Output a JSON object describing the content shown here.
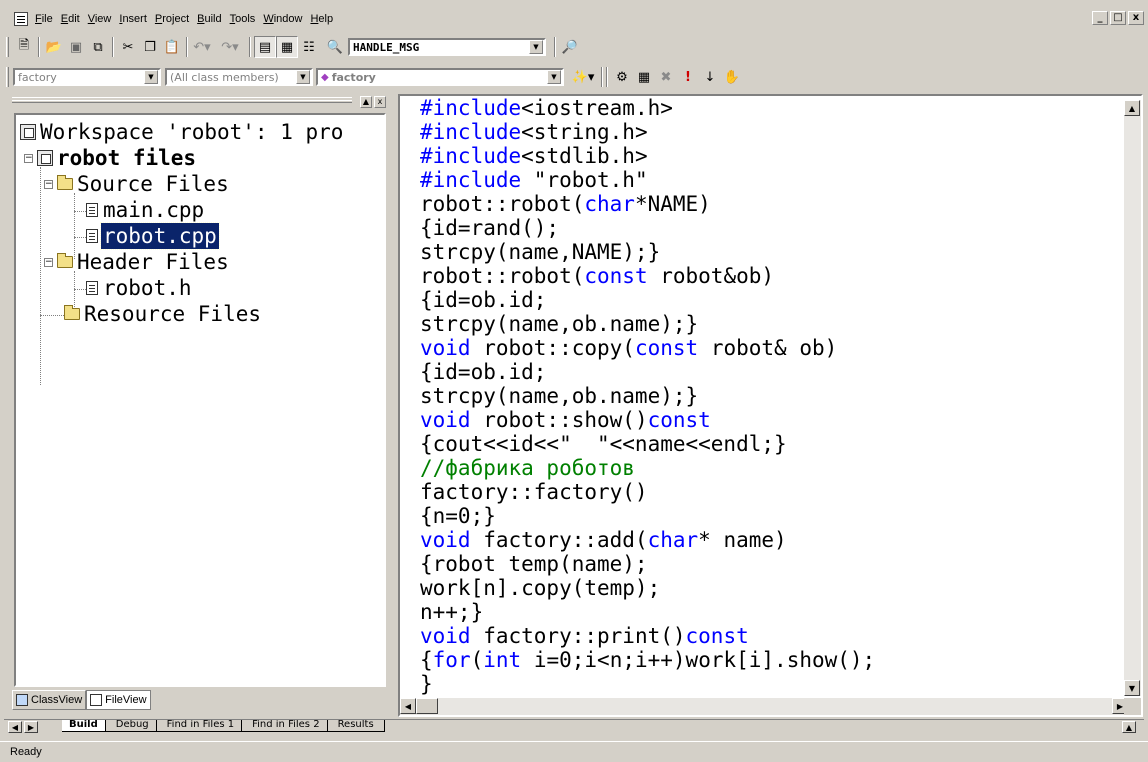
{
  "menu": {
    "items": [
      "File",
      "Edit",
      "View",
      "Insert",
      "Project",
      "Build",
      "Tools",
      "Window",
      "Help"
    ],
    "mdi_controls": [
      "_",
      "□",
      "x"
    ]
  },
  "toolbar": {
    "find_value": "HANDLE_MSG",
    "class_combo": "factory",
    "members_combo": "(All class members)",
    "function_combo": "factory"
  },
  "workspace": {
    "tree": {
      "workspace_label": "Workspace 'robot': 1 pro",
      "project_label": "robot files",
      "source_folder": "Source Files",
      "source_files": [
        "main.cpp",
        "robot.cpp"
      ],
      "header_folder": "Header Files",
      "header_files": [
        "robot.h"
      ],
      "resource_folder": "Resource Files"
    },
    "selected_file": "robot.cpp",
    "tabs": [
      "ClassView",
      "FileView"
    ],
    "active_tab": "FileView"
  },
  "editor": {
    "lines": [
      [
        [
          "kw",
          "#include"
        ],
        [
          "t",
          "<iostream.h>"
        ]
      ],
      [
        [
          "kw",
          "#include"
        ],
        [
          "t",
          "<string.h>"
        ]
      ],
      [
        [
          "kw",
          "#include"
        ],
        [
          "t",
          "<stdlib.h>"
        ]
      ],
      [
        [
          "kw",
          "#include"
        ],
        [
          "t",
          " \"robot.h\""
        ]
      ],
      [
        [
          "t",
          "robot::robot("
        ],
        [
          "kw",
          "char"
        ],
        [
          "t",
          "*NAME)"
        ]
      ],
      [
        [
          "t",
          "{id=rand();"
        ]
      ],
      [
        [
          "t",
          "strcpy(name,NAME);}"
        ]
      ],
      [
        [
          "t",
          "robot::robot("
        ],
        [
          "kw",
          "const"
        ],
        [
          "t",
          " robot&ob)"
        ]
      ],
      [
        [
          "t",
          "{id=ob.id;"
        ]
      ],
      [
        [
          "t",
          "strcpy(name,ob.name);}"
        ]
      ],
      [
        [
          "kw",
          "void"
        ],
        [
          "t",
          " robot::copy("
        ],
        [
          "kw",
          "const"
        ],
        [
          "t",
          " robot& ob)"
        ]
      ],
      [
        [
          "t",
          "{id=ob.id;"
        ]
      ],
      [
        [
          "t",
          "strcpy(name,ob.name);}"
        ]
      ],
      [
        [
          "kw",
          "void"
        ],
        [
          "t",
          " robot::show()"
        ],
        [
          "kw",
          "const"
        ]
      ],
      [
        [
          "t",
          "{cout<<id<<\"  \"<<name<<endl;}"
        ]
      ],
      [
        [
          "cm",
          "//фабрика роботов"
        ]
      ],
      [
        [
          "t",
          "factory::factory()"
        ]
      ],
      [
        [
          "t",
          "{n=0;}"
        ]
      ],
      [
        [
          "kw",
          "void"
        ],
        [
          "t",
          " factory::add("
        ],
        [
          "kw",
          "char"
        ],
        [
          "t",
          "* name)"
        ]
      ],
      [
        [
          "t",
          "{robot temp(name);"
        ]
      ],
      [
        [
          "t",
          "work[n].copy(temp);"
        ]
      ],
      [
        [
          "t",
          "n++;}"
        ]
      ],
      [
        [
          "kw",
          "void"
        ],
        [
          "t",
          " factory::print()"
        ],
        [
          "kw",
          "const"
        ]
      ],
      [
        [
          "t",
          "{"
        ],
        [
          "kw",
          "for"
        ],
        [
          "t",
          "("
        ],
        [
          "kw",
          "int"
        ],
        [
          "t",
          " i=0;i<n;i++)work[i].show();"
        ]
      ],
      [
        [
          "t",
          "}"
        ]
      ]
    ],
    "colors": {
      "keyword": "#0000ff",
      "comment": "#008000",
      "text": "#000000"
    }
  },
  "output": {
    "tabs": [
      "Build",
      "Debug",
      "Find in Files 1",
      "Find in Files 2",
      "Results"
    ]
  },
  "status": {
    "text": "Ready"
  }
}
